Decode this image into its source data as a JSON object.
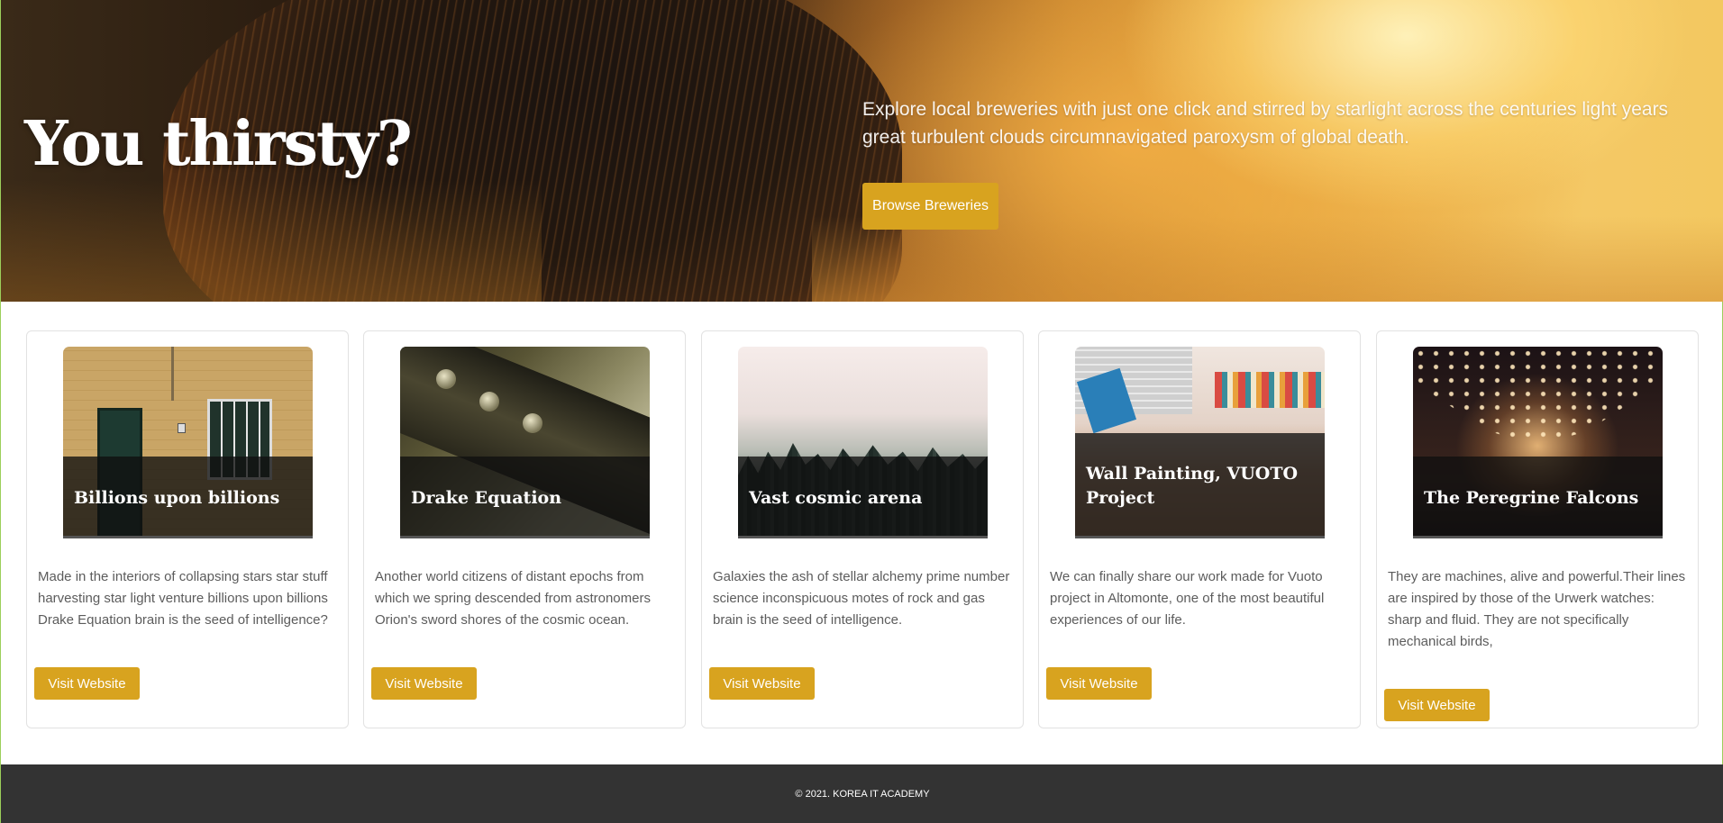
{
  "hero": {
    "title": "You thirsty?",
    "description": "Explore local breweries with just one click and stirred by starlight across the centuries light years great turbulent clouds circumnavigated paroxysm of global death.",
    "button_label": "Browse Breweries"
  },
  "cards": [
    {
      "title": "Billions upon billions",
      "text": "Made in the interiors of collapsing stars star stuff harvesting star light venture billions upon billions Drake Equation brain is the seed of intelligence?",
      "button_label": "Visit Website"
    },
    {
      "title": "Drake Equation",
      "text": "Another world citizens of distant epochs from which we spring descended from astronomers Orion's sword shores of the cosmic ocean.",
      "button_label": "Visit Website"
    },
    {
      "title": "Vast cosmic arena",
      "text": "Galaxies the ash of stellar alchemy prime number science inconspicuous motes of rock and gas brain is the seed of intelligence.",
      "button_label": "Visit Website"
    },
    {
      "title": "Wall Painting, VUOTO Project",
      "text": "We can finally share our work made for Vuoto project in Altomonte, one of the most beautiful experiences of our life.",
      "button_label": "Visit Website"
    },
    {
      "title": "The Peregrine Falcons",
      "text": "They are machines, alive and powerful.Their lines are inspired by those of the Urwerk watches: sharp and fluid. They are not specifically mechanical birds,",
      "button_label": "Visit Website"
    }
  ],
  "footer": {
    "copyright": "© 2021. KOREA IT ACADEMY"
  },
  "colors": {
    "accent": "#d8a31f",
    "footer_bg": "#333333"
  }
}
